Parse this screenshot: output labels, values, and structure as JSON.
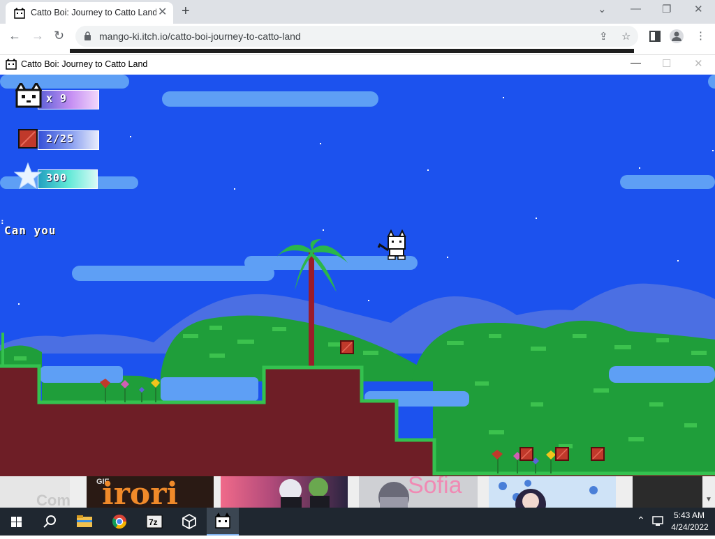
{
  "browser": {
    "tab_title": "Catto Boi: Journey to Catto Land",
    "tab_close": "✕",
    "new_tab": "+",
    "url": "mango-ki.itch.io/catto-boi-journey-to-catto-land"
  },
  "game_window": {
    "title": "Catto Boi: Journey to Catto Land",
    "minimize": "—",
    "maximize": "☐",
    "close": "✕"
  },
  "hud": {
    "lives": "x 9",
    "gems": "2/25",
    "score": "300"
  },
  "dialog": "Can you",
  "thumbnails": {
    "first": "Com",
    "second": "irori",
    "second_badge": "GIF",
    "fourth": "Sofia"
  },
  "taskbar": {
    "time": "5:43 AM",
    "date": "4/24/2022"
  },
  "colors": {
    "sky": "#1c52ee",
    "cloud": "#5e9ff5",
    "mountain": "#4b6fe3",
    "bush": "#1f9e3a",
    "dirt": "#6e1e26",
    "gem": "#c0392b"
  }
}
